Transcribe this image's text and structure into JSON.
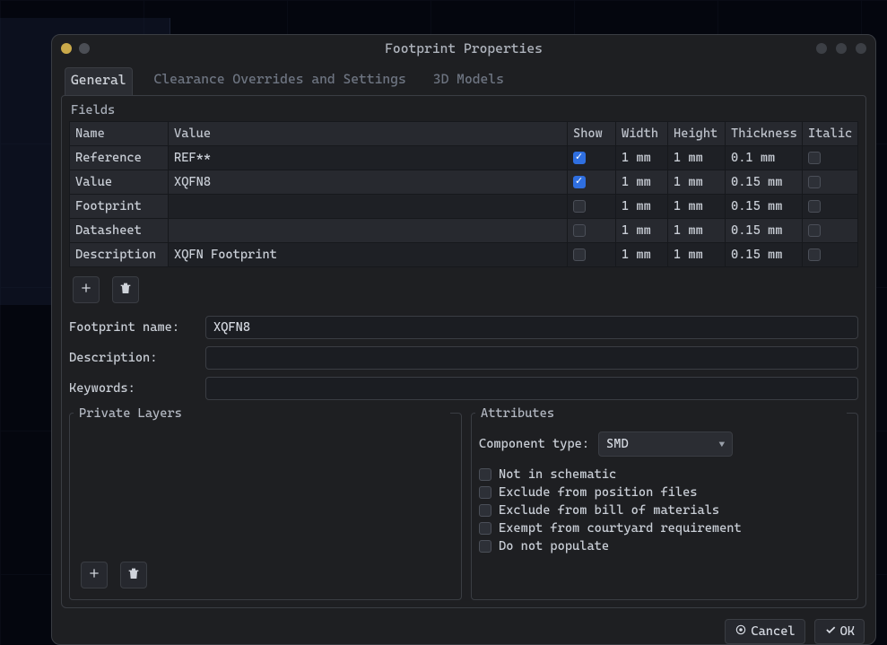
{
  "dialog": {
    "title": "Footprint Properties"
  },
  "tabs": [
    {
      "label": "General",
      "active": true
    },
    {
      "label": "Clearance Overrides and Settings",
      "active": false
    },
    {
      "label": "3D Models",
      "active": false
    }
  ],
  "fields_group_label": "Fields",
  "fields_headers": {
    "name": "Name",
    "value": "Value",
    "show": "Show",
    "width": "Width",
    "height": "Height",
    "thickness": "Thickness",
    "italic": "Italic"
  },
  "fields_rows": [
    {
      "name": "Reference",
      "value": "REF**",
      "show": true,
      "width": "1 mm",
      "height": "1 mm",
      "thickness": "0.1 mm",
      "italic": false
    },
    {
      "name": "Value",
      "value": "XQFN8",
      "show": true,
      "width": "1 mm",
      "height": "1 mm",
      "thickness": "0.15 mm",
      "italic": false
    },
    {
      "name": "Footprint",
      "value": "",
      "show": false,
      "width": "1 mm",
      "height": "1 mm",
      "thickness": "0.15 mm",
      "italic": false
    },
    {
      "name": "Datasheet",
      "value": "",
      "show": false,
      "width": "1 mm",
      "height": "1 mm",
      "thickness": "0.15 mm",
      "italic": false
    },
    {
      "name": "Description",
      "value": "XQFN Footprint",
      "show": false,
      "width": "1 mm",
      "height": "1 mm",
      "thickness": "0.15 mm",
      "italic": false
    }
  ],
  "form": {
    "footprint_name_label": "Footprint name:",
    "footprint_name_value": "XQFN8",
    "description_label": "Description:",
    "description_value": "",
    "keywords_label": "Keywords:",
    "keywords_value": ""
  },
  "private_layers_label": "Private Layers",
  "attributes": {
    "label": "Attributes",
    "component_type_label": "Component type:",
    "component_type_value": "SMD",
    "checks": [
      {
        "label": "Not in schematic",
        "checked": false
      },
      {
        "label": "Exclude from position files",
        "checked": false
      },
      {
        "label": "Exclude from bill of materials",
        "checked": false
      },
      {
        "label": "Exempt from courtyard requirement",
        "checked": false
      },
      {
        "label": "Do not populate",
        "checked": false
      }
    ]
  },
  "buttons": {
    "cancel": "Cancel",
    "ok": "OK"
  }
}
